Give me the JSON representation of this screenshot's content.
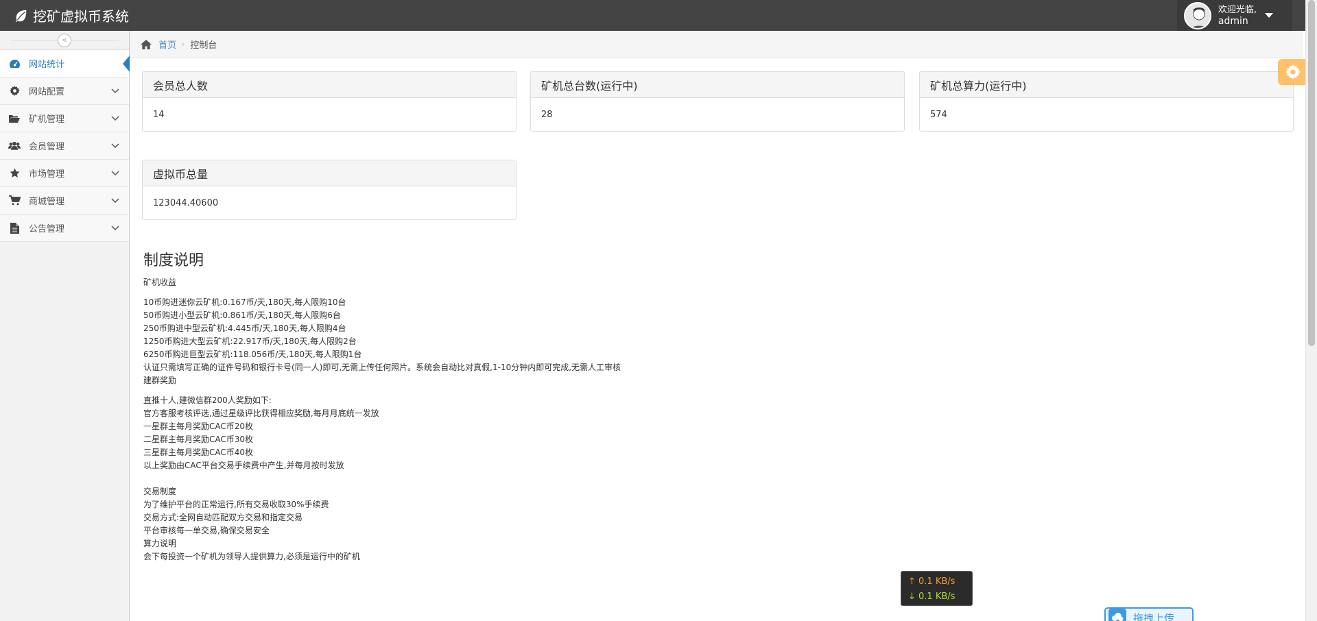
{
  "app": {
    "title": "挖矿虚拟币系统"
  },
  "user": {
    "greeting": "欢迎光临,",
    "name": "admin"
  },
  "sidebar": {
    "items": [
      {
        "label": "网站统计",
        "icon": "dashboard-icon",
        "active": true
      },
      {
        "label": "网站配置",
        "icon": "gear-icon"
      },
      {
        "label": "矿机管理",
        "icon": "folder-open-icon"
      },
      {
        "label": "会员管理",
        "icon": "users-icon"
      },
      {
        "label": "市场管理",
        "icon": "star-icon"
      },
      {
        "label": "商城管理",
        "icon": "cart-icon"
      },
      {
        "label": "公告管理",
        "icon": "file-icon"
      }
    ]
  },
  "breadcrumb": {
    "home": "首页",
    "current": "控制台"
  },
  "stats": [
    {
      "title": "会员总人数",
      "value": "14"
    },
    {
      "title": "矿机总台数(运行中)",
      "value": "28"
    },
    {
      "title": "矿机总算力(运行中)",
      "value": "574"
    },
    {
      "title": "虚拟币总量",
      "value": "123044.40600"
    }
  ],
  "rules": {
    "heading": "制度说明",
    "mining_title": "矿机收益",
    "mining_lines": [
      "10币购进迷你云矿机:0.167币/天,180天,每人限购10台",
      "50币购进小型云矿机:0.861币/天,180天,每人限购6台",
      "250币购进中型云矿机:4.445币/天,180天,每人限购4台",
      "1250币购进大型云矿机:22.917币/天,180天,每人限购2台",
      "6250币购进巨型云矿机:118.056币/天,180天,每人限购1台"
    ],
    "auth_line": "认证只需填写正确的证件号码和银行卡号(同一人)即可,无需上传任何照片。系统会自动比对真假,1-10分钟内即可完成,无需人工审核",
    "group_title": "建群奖励",
    "group_lines": [
      "直推十人,建微信群200人奖励如下:",
      "官方客服考核评选,通过星级评比获得相应奖励,每月月底统一发放",
      "一星群主每月奖励CAC币20枚",
      "二星群主每月奖励CAC币30枚",
      "三星群主每月奖励CAC币40枚",
      "以上奖励由CAC平台交易手续费中产生,并每月按时发放"
    ],
    "trade_title": "交易制度",
    "trade_lines": [
      "为了维护平台的正常运行,所有交易收取30%手续费",
      "交易方式:全网自动匹配双方交易和指定交易",
      "平台审核每一单交易,确保交易安全"
    ],
    "power_title": "算力说明",
    "power_lines": [
      "会下每投资一个矿机为领导人提供算力,必须是运行中的矿机"
    ]
  },
  "netspeed": {
    "up": "↑ 0.1 KB/s",
    "down": "↓ 0.1 KB/s"
  },
  "upload": {
    "label": "拖拽上传"
  }
}
